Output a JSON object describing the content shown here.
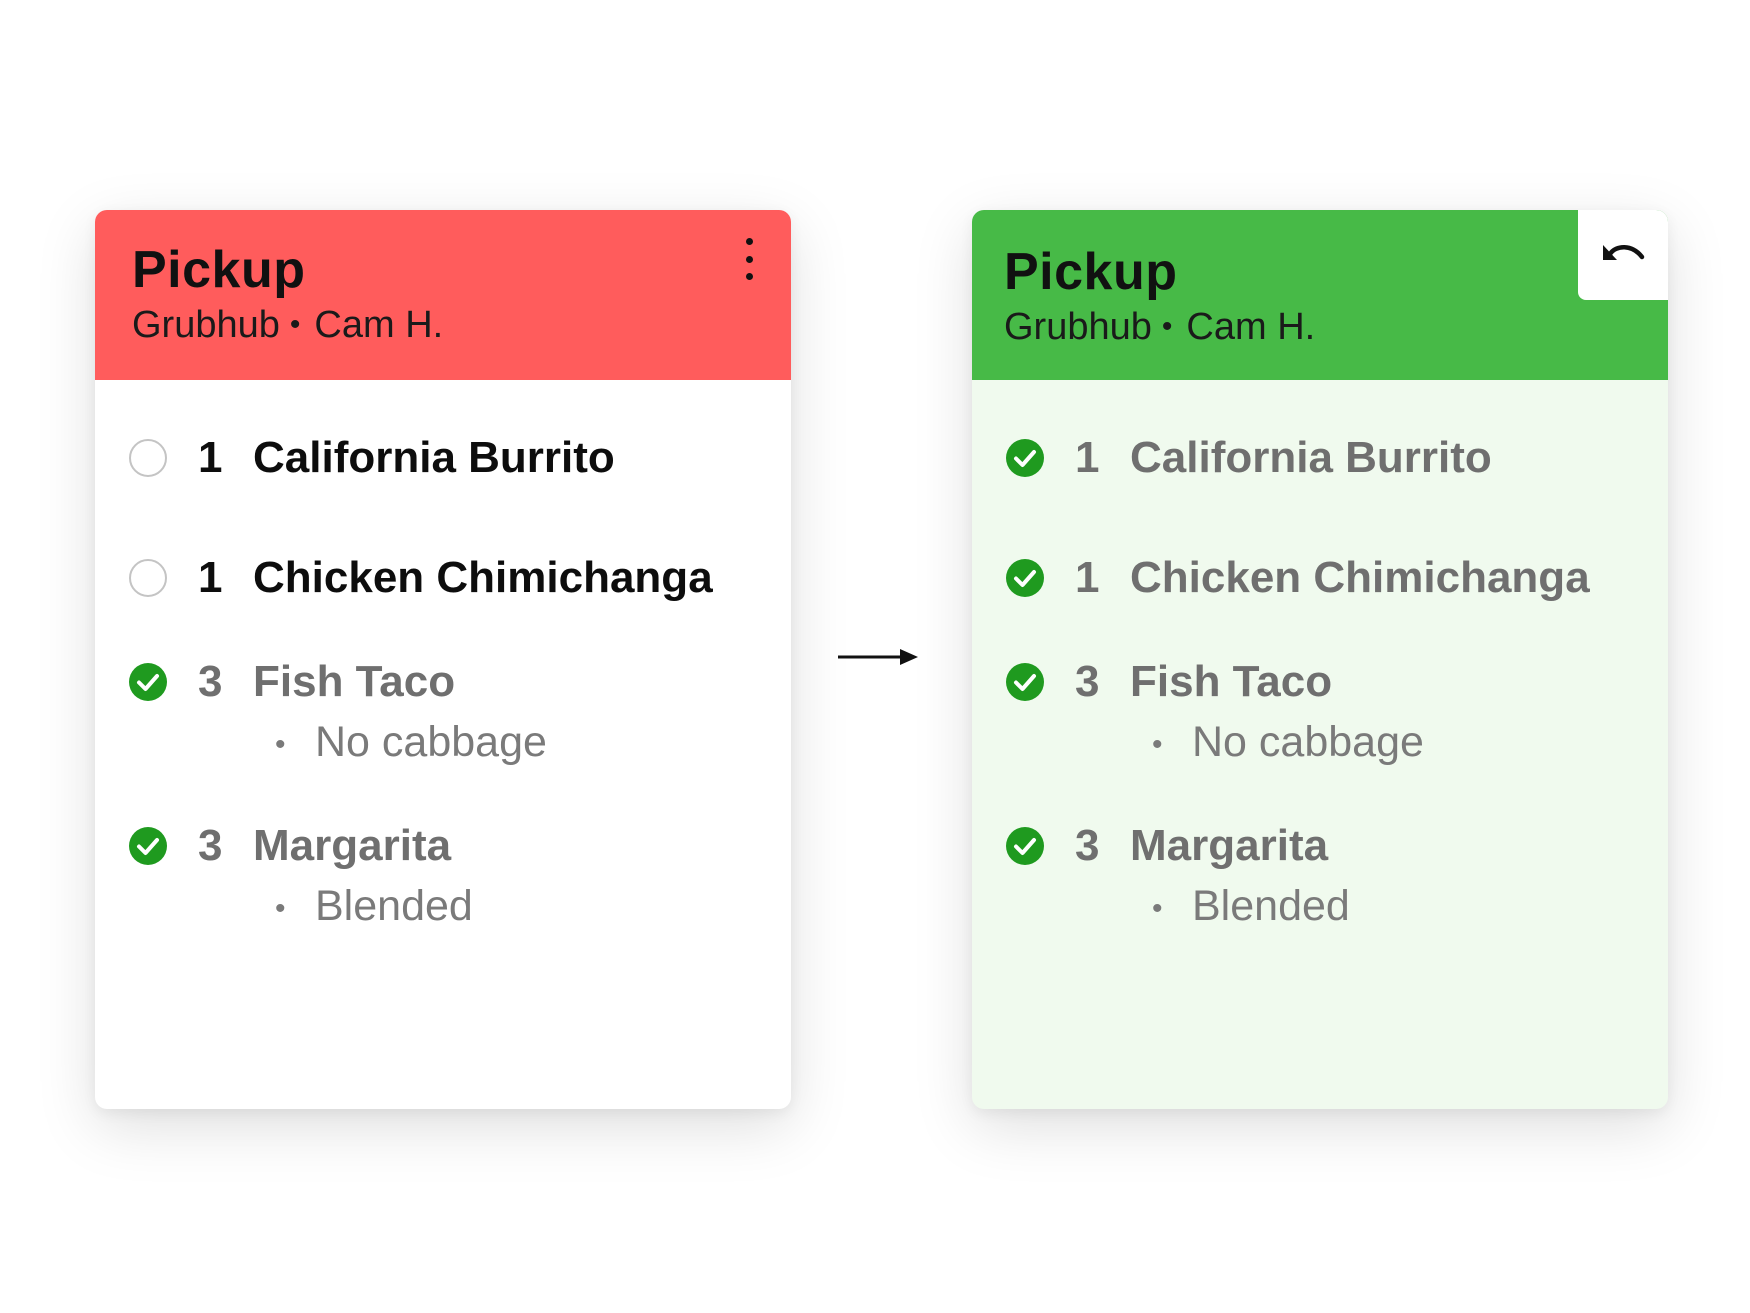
{
  "colors": {
    "pending_header": "#ff5c5c",
    "complete_header": "#47ba47",
    "complete_body": "#f0faee",
    "check": "#1f9a1f"
  },
  "before": {
    "title": "Pickup",
    "source": "Grubhub",
    "separator": "•",
    "customer": "Cam H.",
    "menu_icon": "more-vertical-icon",
    "items": [
      {
        "qty": "1",
        "name": "California Burrito",
        "status": "unchecked",
        "modifiers": []
      },
      {
        "qty": "1",
        "name": "Chicken Chimichanga",
        "status": "unchecked",
        "modifiers": []
      },
      {
        "qty": "3",
        "name": "Fish Taco",
        "status": "checked",
        "modifiers": [
          "No cabbage"
        ]
      },
      {
        "qty": "3",
        "name": "Margarita",
        "status": "checked",
        "modifiers": [
          "Blended"
        ]
      }
    ]
  },
  "after": {
    "title": "Pickup",
    "source": "Grubhub",
    "separator": "•",
    "customer": "Cam H.",
    "undo_icon": "undo-icon",
    "items": [
      {
        "qty": "1",
        "name": "California Burrito",
        "status": "checked",
        "modifiers": []
      },
      {
        "qty": "1",
        "name": "Chicken Chimichanga",
        "status": "checked",
        "modifiers": []
      },
      {
        "qty": "3",
        "name": "Fish Taco",
        "status": "checked",
        "modifiers": [
          "No cabbage"
        ]
      },
      {
        "qty": "3",
        "name": "Margarita",
        "status": "checked",
        "modifiers": [
          "Blended"
        ]
      }
    ]
  },
  "transition_icon": "arrow-right-icon",
  "bullet": "•"
}
